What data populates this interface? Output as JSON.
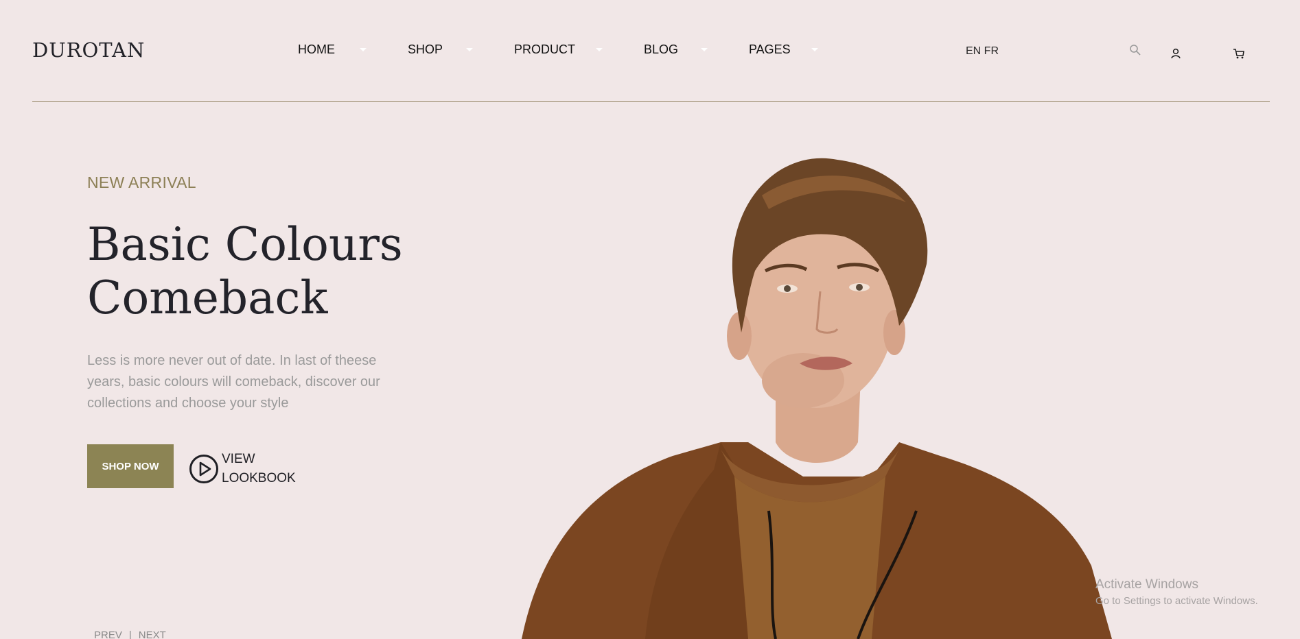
{
  "header": {
    "logo": "DUROTAN",
    "nav": [
      {
        "label": "HOME"
      },
      {
        "label": "SHOP"
      },
      {
        "label": "PRODUCT"
      },
      {
        "label": "BLOG"
      },
      {
        "label": "PAGES"
      }
    ],
    "lang": "EN FR",
    "icons": [
      "search-icon",
      "user-icon",
      "cart-icon"
    ]
  },
  "hero": {
    "eyebrow": "NEW ARRIVAL",
    "title_line1": "Basic Colours",
    "title_line2": "Comeback",
    "description": "Less is more never out of date. In last of theese years, basic colours will comeback, discover our collections and choose your style",
    "shop_button": "SHOP NOW",
    "lookbook_line1": "VIEW",
    "lookbook_line2": "LOOKBOOK",
    "prev": "PREV",
    "separator": "|",
    "next": "NEXT"
  },
  "watermark": {
    "line1": "Activate Windows",
    "line2": "Go to Settings to activate Windows."
  },
  "colors": {
    "background": "#f1e7e7",
    "accent": "#8c8454",
    "eyebrow": "#8c7f55",
    "divider": "#8d7e5a"
  }
}
